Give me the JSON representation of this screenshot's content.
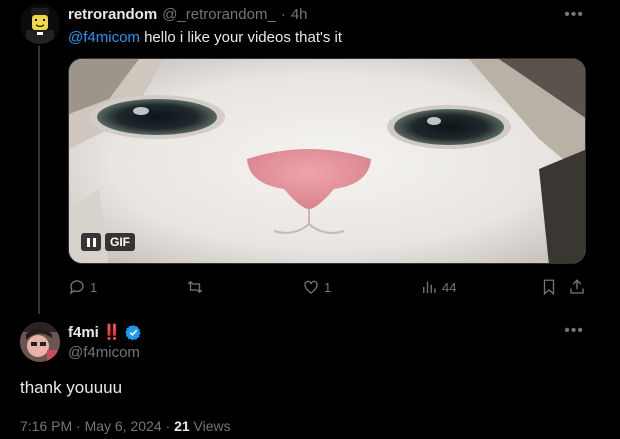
{
  "reply": {
    "name": "retrorandom",
    "handle": "@_retrorandom_",
    "separator": "·",
    "time": "4h",
    "more": "•••",
    "mention": "@f4micom",
    "text": " hello i like your videos that's it",
    "gif_label": "GIF",
    "stats": {
      "replies": "1",
      "reposts": "",
      "likes": "1",
      "views": "44"
    }
  },
  "tweet": {
    "name": "f4mi",
    "name_emoji": "‼️",
    "verified": true,
    "handle": "@f4micom",
    "more": "•••",
    "text": "thank youuuu",
    "timestamp": "7:16 PM · May 6, 2024 · ",
    "views_count": "21",
    "views_label": " Views"
  },
  "colors": {
    "accent": "#1d9bf0",
    "muted": "#71767b",
    "text": "#e7e9ea",
    "bg": "#000000",
    "alert": "#f4212e"
  }
}
